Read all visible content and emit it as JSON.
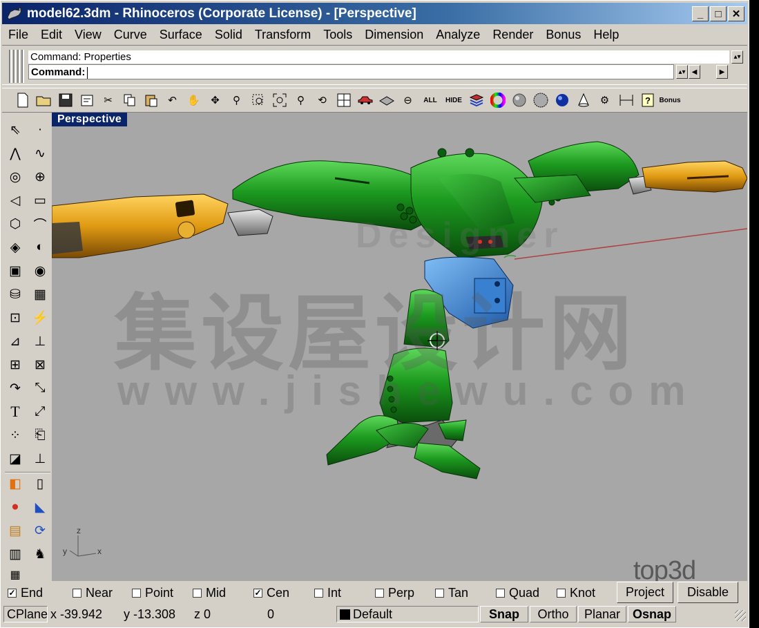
{
  "window": {
    "title": "model62.3dm - Rhinoceros (Corporate License) - [Perspective]",
    "minimize": "_",
    "maximize": "□",
    "close": "✕"
  },
  "menu": [
    "File",
    "Edit",
    "View",
    "Curve",
    "Surface",
    "Solid",
    "Transform",
    "Tools",
    "Dimension",
    "Analyze",
    "Render",
    "Bonus",
    "Help"
  ],
  "command": {
    "history": "Command:  Properties",
    "prompt": "Command:"
  },
  "toolbar": {
    "all_label": "ALL",
    "hide_label": "HIDE",
    "bonus_label": "Bonus"
  },
  "viewport": {
    "label": "Perspective",
    "axis_z": "z",
    "axis_y": "y",
    "axis_x": "x",
    "logo_text": "top3d",
    "watermark_cn": "集设屋设计网",
    "watermark_url": "www.jishewu.com",
    "watermark_en": "Designer"
  },
  "osnap": {
    "items": [
      {
        "label": "End",
        "checked": true
      },
      {
        "label": "Near",
        "checked": false
      },
      {
        "label": "Point",
        "checked": false
      },
      {
        "label": "Mid",
        "checked": false
      },
      {
        "label": "Cen",
        "checked": true
      },
      {
        "label": "Int",
        "checked": false
      },
      {
        "label": "Perp",
        "checked": false
      },
      {
        "label": "Tan",
        "checked": false
      },
      {
        "label": "Quad",
        "checked": false
      },
      {
        "label": "Knot",
        "checked": false
      }
    ],
    "project_label": "Project",
    "disable_label": "Disable"
  },
  "status": {
    "cplane": "CPlane",
    "x": "x -39.942",
    "y": "y -13.308",
    "z": "z 0",
    "extra": "0",
    "layer": "Default",
    "layer_color": "#000000",
    "snap": "Snap",
    "ortho": "Ortho",
    "planar": "Planar",
    "osnap": "Osnap"
  },
  "colors": {
    "title_bar": "#0a246a",
    "viewport_bg": "#a7a7a7",
    "robot_green": "#1f8a1f",
    "robot_yellow": "#e0a21a",
    "robot_blue": "#3a7fd0"
  }
}
